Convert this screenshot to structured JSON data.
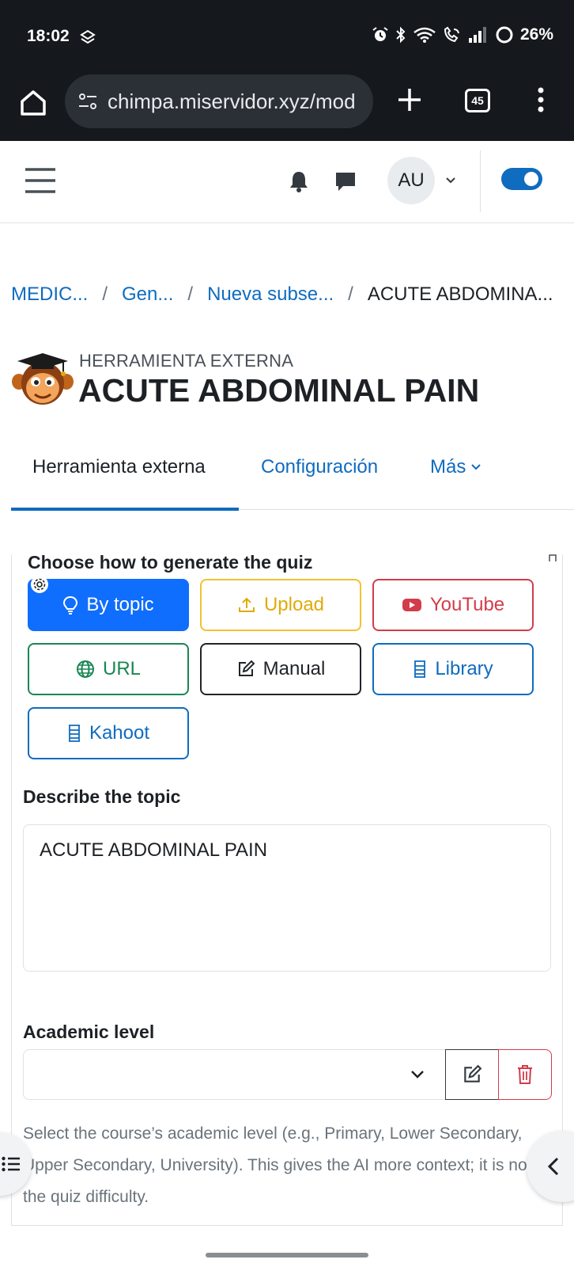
{
  "status_bar": {
    "time": "18:02",
    "battery": "26%",
    "icons": [
      "alarm-icon",
      "bluetooth-icon",
      "wifi-icon",
      "wifi-call-icon",
      "signal-icon",
      "battery-icon"
    ]
  },
  "browser": {
    "url": "chimpa.miservidor.xyz/mod",
    "tab_count": "45"
  },
  "navbar": {
    "avatar_initials": "AU",
    "edit_mode_on": true
  },
  "breadcrumb": {
    "items": [
      "MEDIC...",
      "Gen...",
      "Nueva subse..."
    ],
    "separator": "/",
    "current": "ACUTE ABDOMINA..."
  },
  "header": {
    "subtitle": "HERRAMIENTA EXTERNA",
    "title": "ACUTE ABDOMINAL PAIN"
  },
  "tabs": {
    "active": "Herramienta externa",
    "config": "Configuración",
    "more": "Más"
  },
  "quiz": {
    "heading": "Choose how to generate the quiz",
    "buttons": {
      "topic": "By topic",
      "upload": "Upload",
      "youtube": "YouTube",
      "url": "URL",
      "manual": "Manual",
      "library": "Library",
      "kahoot": "Kahoot"
    },
    "topic_label": "Describe the topic",
    "topic_value": "ACUTE ABDOMINAL PAIN",
    "level_label": "Academic level",
    "level_value": "",
    "level_help": "Select the course’s academic level (e.g., Primary, Lower Secondary, Upper Secondary, University). This gives the AI more context; it is not the quiz difficulty."
  },
  "colors": {
    "primary": "#0f6cbf",
    "topic_button": "#0f6efd",
    "upload": "#f1c232",
    "youtube": "#d33c4a",
    "url": "#198754",
    "status_bar_bg": "#15181c"
  }
}
